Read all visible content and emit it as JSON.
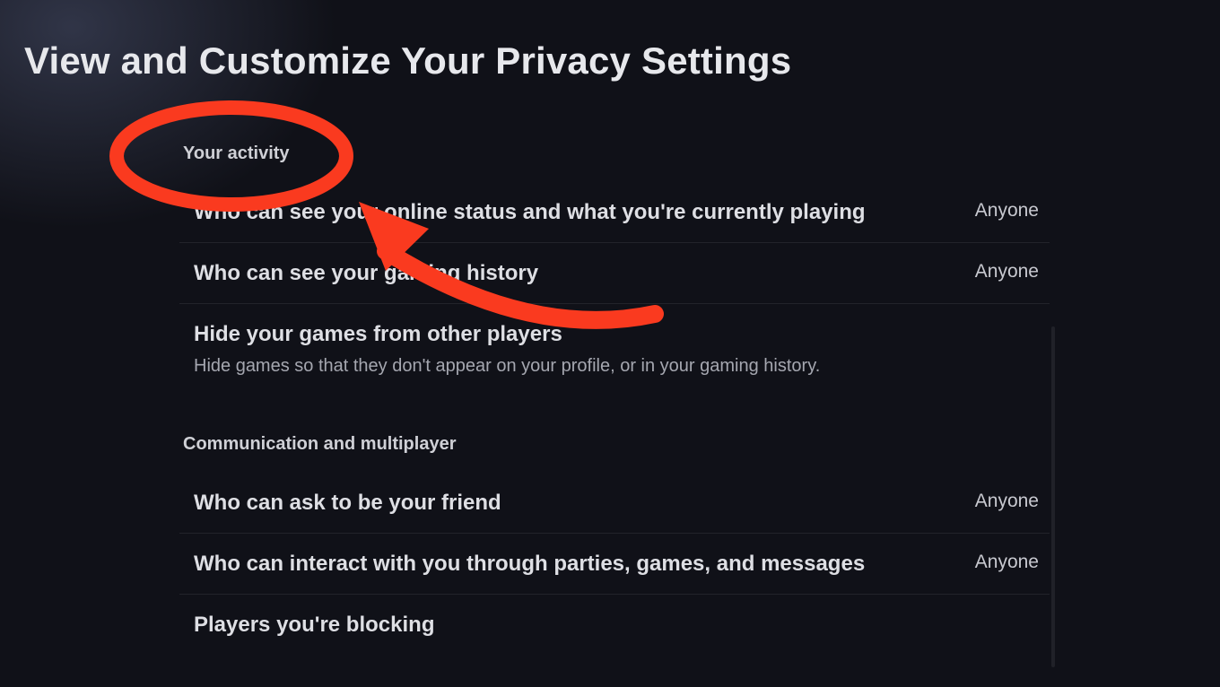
{
  "header": {
    "title": "View and Customize Your Privacy Settings"
  },
  "sections": {
    "activity": {
      "header": "Your activity",
      "rows": {
        "online_status": {
          "label": "Who can see your online status and what you're currently playing",
          "value": "Anyone"
        },
        "gaming_history": {
          "label": "Who can see your gaming history",
          "value": "Anyone"
        },
        "hide_games": {
          "label": "Hide your games from other players",
          "sub": "Hide games so that they don't appear on your profile, or in your gaming history."
        }
      }
    },
    "communication": {
      "header": "Communication and multiplayer",
      "rows": {
        "friend_requests": {
          "label": "Who can ask to be your friend",
          "value": "Anyone"
        },
        "interact": {
          "label": "Who can interact with you through parties, games, and messages",
          "value": "Anyone"
        },
        "blocking": {
          "label": "Players you're blocking"
        }
      }
    }
  },
  "annotation": {
    "shape": "ellipse-with-curved-arrow",
    "color": "#fa3a1f",
    "target_label": "Your activity"
  }
}
